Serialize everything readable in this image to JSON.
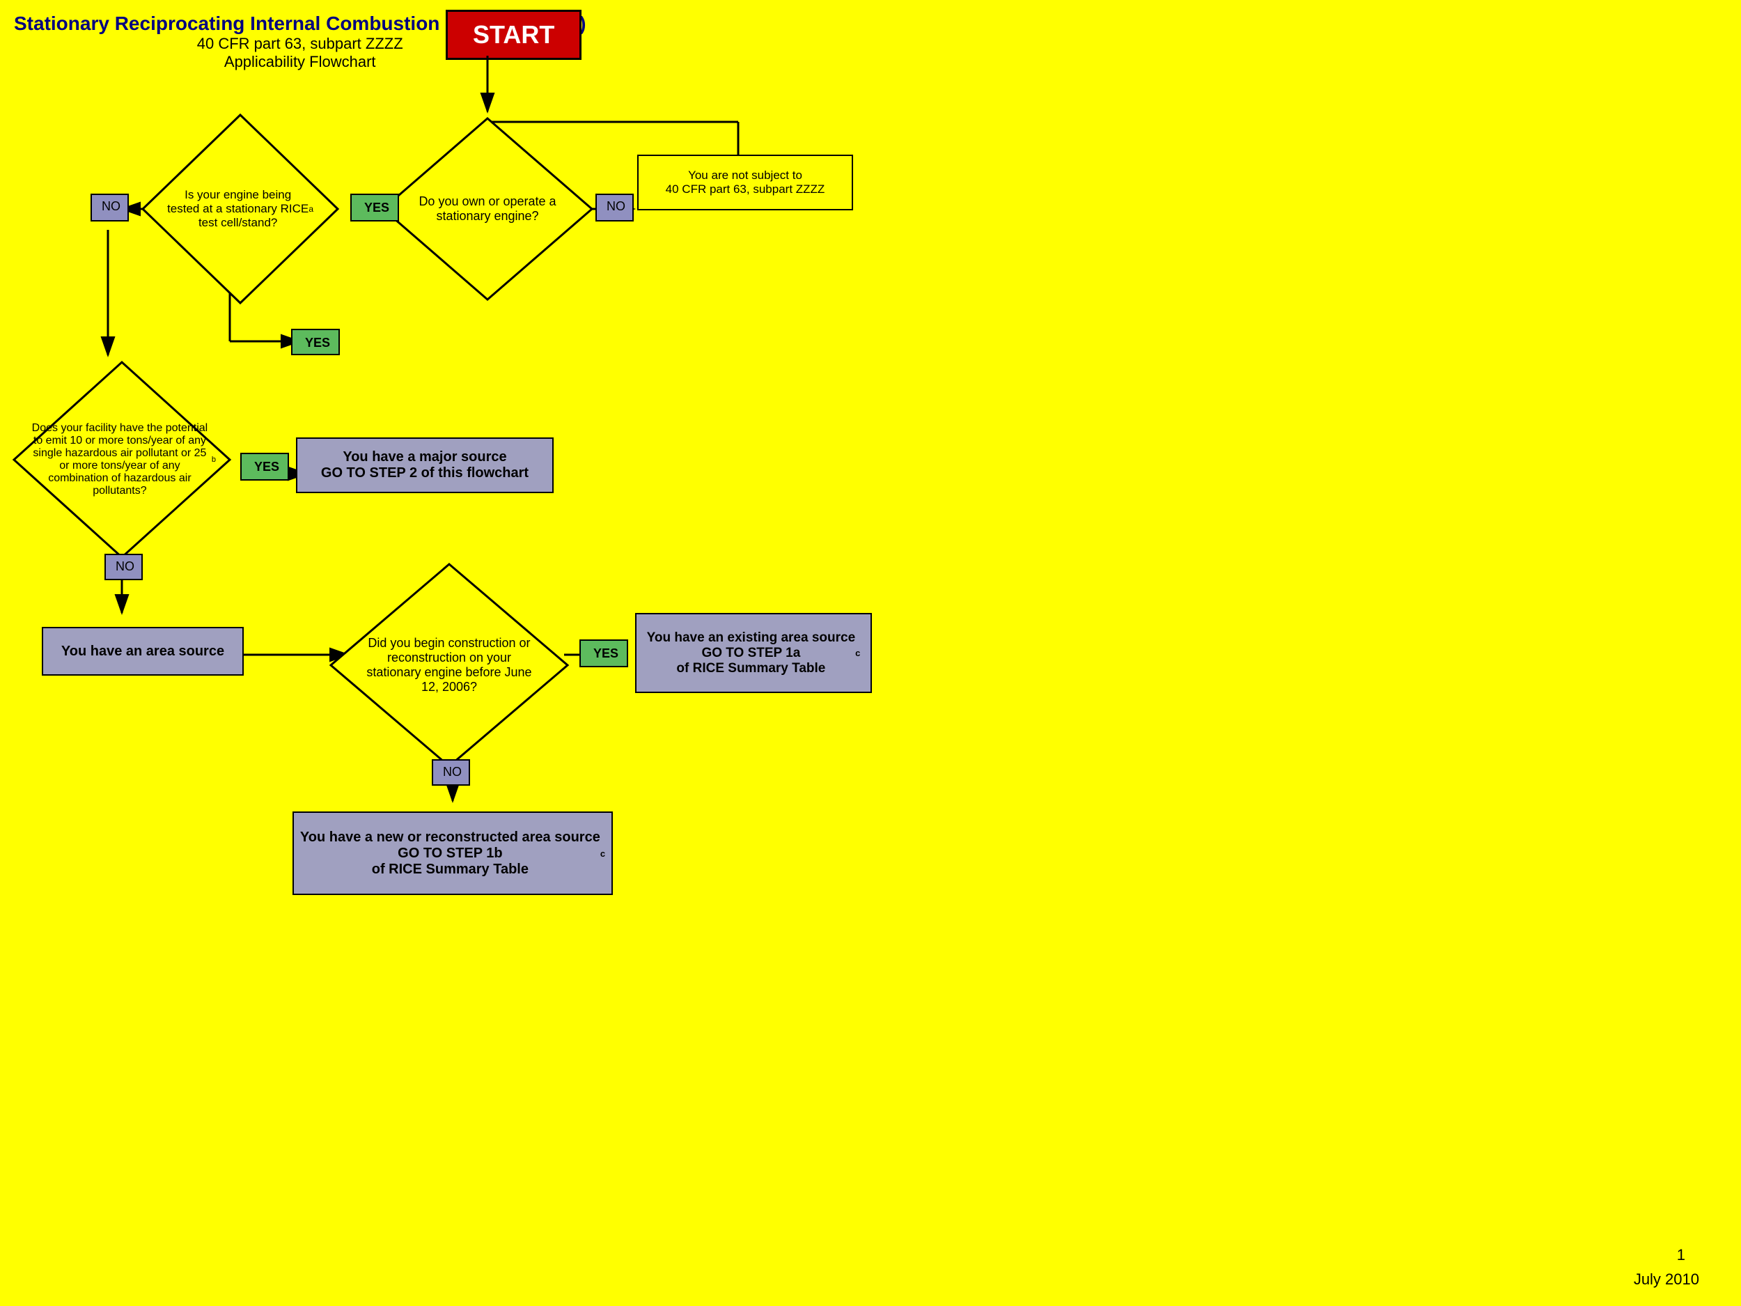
{
  "header": {
    "title": "Stationary Reciprocating Internal Combustion Engines (RICE)",
    "subtitle1": "40 CFR part 63, subpart ZZZZ",
    "subtitle2": "Applicability Flowchart"
  },
  "start": "START",
  "diamonds": {
    "d1": {
      "text": "Is your engine being tested at a stationary RICE test cell/stand?á"
    },
    "d2": {
      "text": "Do you own or operate a stationary engine?"
    },
    "d3": {
      "text": "Does your facility have the potential to emit 10 or more tons/year of any single hazardous air pollutant or 25 or more tons/year of any combination of hazardous air pollutants?ᵇ"
    },
    "d4": {
      "text": "Did you begin construction or reconstruction on your stationary engine before June 12, 2006?"
    }
  },
  "labels": {
    "yes1": "YES",
    "yes2": "YES",
    "yes3": "YES",
    "yes4": "YES",
    "no1": "NO",
    "no2": "NO",
    "no3": "NO",
    "no4": "NO"
  },
  "boxes": {
    "not_subject": "You are not subject to\n40 CFR part 63, subpart ZZZZ",
    "major_source": "You have a major source\nGO TO STEP 2 of this flowchart",
    "area_source": "You have an area source",
    "existing_area": "You have an existing area source\nGO TO STEP 1a\nof  RICE Summary Tableᶜ",
    "new_area": "You have a new or reconstructed area source\nGO TO STEP 1b\nof  RICE Summary Tableᶜ"
  },
  "footer": {
    "page": "1",
    "date": "July 2010"
  }
}
